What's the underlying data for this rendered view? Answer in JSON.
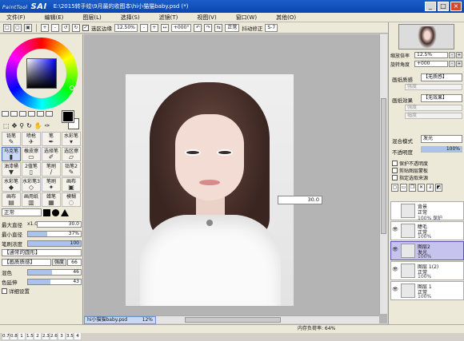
{
  "app": {
    "logo_small": "PaintTool",
    "logo": "SAI",
    "title": "E:\\2015转手绘\\9月最的收图本\\hi小猫猫baby.psd (*)"
  },
  "menu": [
    "文件(F)",
    "编辑(E)",
    "图层(L)",
    "选择(S)",
    "滤镜(T)",
    "视图(V)",
    "窗口(W)",
    "其他(O)"
  ],
  "toolbar": {
    "selection_edge_label": "选区边缘",
    "zoom": "12.50%",
    "rotation": "+000°",
    "blend_mode": "正常",
    "stabilizer_label": "抖动修正",
    "stabilizer": "S-7"
  },
  "tools": [
    {
      "label": "铅笔",
      "icon": "pencil-icon",
      "glyph": "✎"
    },
    {
      "label": "喷枪",
      "icon": "airbrush-icon",
      "glyph": "✈"
    },
    {
      "label": "笔",
      "icon": "pen-icon",
      "glyph": "✒"
    },
    {
      "label": "水彩笔",
      "icon": "watercolor-brush-icon",
      "glyph": "▾"
    },
    {
      "label": "马克笔",
      "icon": "marker-icon",
      "glyph": "▮",
      "selected": true
    },
    {
      "label": "橡皮擦",
      "icon": "eraser-icon",
      "glyph": "▭"
    },
    {
      "label": "选择笔",
      "icon": "select-pen-icon",
      "glyph": "✐"
    },
    {
      "label": "选区擦",
      "icon": "select-eraser-icon",
      "glyph": "▱"
    },
    {
      "label": "油漆桶",
      "icon": "bucket-icon",
      "glyph": "▼"
    },
    {
      "label": "2值笔",
      "icon": "binary-pen-icon",
      "glyph": "▯"
    },
    {
      "label": "笔刷",
      "icon": "brush-icon",
      "glyph": "/"
    },
    {
      "label": "铅笔2",
      "icon": "pencil2-icon",
      "glyph": "✎"
    },
    {
      "label": "水彩笔",
      "icon": "watercolor-icon",
      "glyph": "◆"
    },
    {
      "label": "水彩笔3",
      "icon": "watercolor3-icon",
      "glyph": "◇"
    },
    {
      "label": "笔刷",
      "icon": "brush2-icon",
      "glyph": "✦"
    },
    {
      "label": "画布",
      "icon": "canvas-icon",
      "glyph": "▣"
    },
    {
      "label": "画布",
      "icon": "canvas2-icon",
      "glyph": "▤"
    },
    {
      "label": "画用纸",
      "icon": "paper-icon",
      "glyph": "▥"
    },
    {
      "label": "蜡笔",
      "icon": "crayon-icon",
      "glyph": "▦"
    },
    {
      "label": "模糊",
      "icon": "blur-icon",
      "glyph": "◌"
    }
  ],
  "brush": {
    "mode": "正常",
    "max_size_label": "最大直径",
    "max_size_multiplier": "x1.0",
    "max_size": "30.0",
    "min_size_label": "最小直径",
    "min_size_percent": 37,
    "min_size": "37%",
    "density_label": "笔刷浓度",
    "density_percent": 100,
    "density": "100",
    "shape_select": "【通常的圆形】",
    "texture_select": "【画质质感】",
    "texture_strength_label": "强度",
    "texture_strength": "66",
    "mix_label": "混色",
    "mix_percent": 46,
    "mix": "46",
    "extend_label": "色延伸",
    "extend_percent": 43,
    "extend": "43",
    "detail_label": "详细设置"
  },
  "brush_sizes": [
    "0.7",
    "0.8",
    "1",
    "1.5",
    "2",
    "2.3",
    "2.6",
    "3",
    "3.5",
    "4"
  ],
  "canvas": {
    "size_readout": "30.0"
  },
  "document_tab": {
    "name": "hi小猫猫baby.psd",
    "zoom": "12%"
  },
  "statusbar": {
    "memory": "内存负荷率: 64%"
  },
  "navigator": {
    "zoom_label": "缩放倍率",
    "zoom": "12.5%",
    "angle_label": "旋转角度",
    "angle": "+000"
  },
  "right_panel": {
    "paper_texture_label": "画纸质感",
    "paper_texture": "【无质感】",
    "paper_effect_label": "画纸效果",
    "paper_effect": "【无效果】",
    "strength_placeholder": "强度",
    "width_placeholder": "幅度",
    "blend_label": "混合模式",
    "blend": "发光",
    "opacity_label": "不透明度",
    "opacity": "100%",
    "checks": [
      "保护不透明度",
      "剪贴图层蒙板",
      "指定选取来源"
    ]
  },
  "layers": [
    {
      "name": "背景",
      "mode": "正常",
      "opacity": "100% 保护",
      "visible": false,
      "selected": false
    },
    {
      "name": "睫毛",
      "mode": "正常",
      "opacity": "100%",
      "visible": true,
      "selected": false
    },
    {
      "name": "图层2",
      "mode": "发光",
      "opacity": "100%",
      "visible": true,
      "selected": true
    },
    {
      "name": "图层 1(2)",
      "mode": "正常",
      "opacity": "100%",
      "visible": true,
      "selected": false
    },
    {
      "name": "图层 1",
      "mode": "正常",
      "opacity": "100%",
      "visible": true,
      "selected": false
    }
  ]
}
